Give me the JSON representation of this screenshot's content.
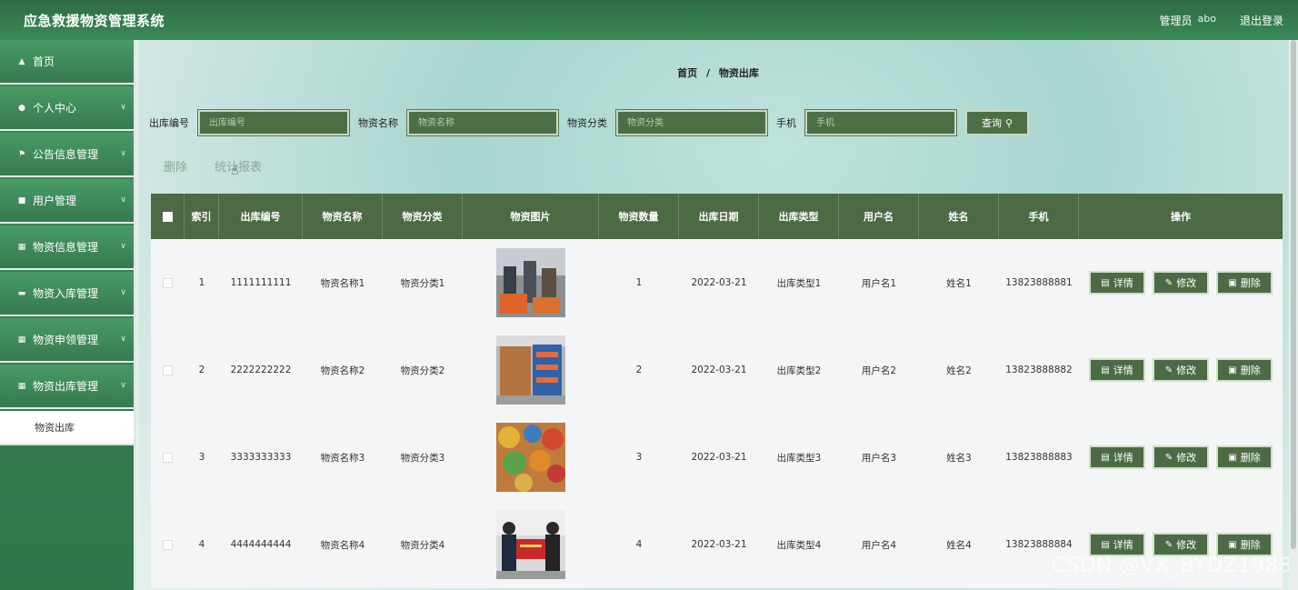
{
  "app": {
    "title": "应急救援物资管理系统"
  },
  "topbar": {
    "role_label": "管理员",
    "username": "abo",
    "logout_label": "退出登录"
  },
  "sidebar": {
    "items": [
      {
        "label": "首页",
        "icon": "home-icon",
        "has_children": false
      },
      {
        "label": "个人中心",
        "icon": "user-icon",
        "has_children": true
      },
      {
        "label": "公告信息管理",
        "icon": "flag-icon",
        "has_children": true
      },
      {
        "label": "用户管理",
        "icon": "card-icon",
        "has_children": true
      },
      {
        "label": "物资信息管理",
        "icon": "grid-icon",
        "has_children": true
      },
      {
        "label": "物资入库管理",
        "icon": "chat-icon",
        "has_children": true
      },
      {
        "label": "物资申领管理",
        "icon": "grid-icon",
        "has_children": true
      },
      {
        "label": "物资出库管理",
        "icon": "grid-icon",
        "has_children": true
      }
    ],
    "active_sub": "物资出库"
  },
  "breadcrumb": {
    "home": "首页",
    "separator": "/",
    "current": "物资出库"
  },
  "search": {
    "fields": [
      {
        "label": "出库编号",
        "placeholder": "出库编号",
        "value": ""
      },
      {
        "label": "物资名称",
        "placeholder": "物资名称",
        "value": ""
      },
      {
        "label": "物资分类",
        "placeholder": "物资分类",
        "value": ""
      },
      {
        "label": "手机",
        "placeholder": "手机",
        "value": ""
      }
    ],
    "query_label": "查询"
  },
  "actions": {
    "delete_label": "删除",
    "report_label": "统计报表"
  },
  "table": {
    "headers": [
      "索引",
      "出库编号",
      "物资名称",
      "物资分类",
      "物资图片",
      "物资数量",
      "出库日期",
      "出库类型",
      "用户名",
      "姓名",
      "手机",
      "操作"
    ],
    "rows": [
      {
        "index": "1",
        "code": "1111111111",
        "name": "物资名称1",
        "category": "物资分类1",
        "qty": "1",
        "date": "2022-03-21",
        "type": "出库类型1",
        "username": "用户名1",
        "realname": "姓名1",
        "phone": "13823888881"
      },
      {
        "index": "2",
        "code": "2222222222",
        "name": "物资名称2",
        "category": "物资分类2",
        "qty": "2",
        "date": "2022-03-21",
        "type": "出库类型2",
        "username": "用户名2",
        "realname": "姓名2",
        "phone": "13823888882"
      },
      {
        "index": "3",
        "code": "3333333333",
        "name": "物资名称3",
        "category": "物资分类3",
        "qty": "3",
        "date": "2022-03-21",
        "type": "出库类型3",
        "username": "用户名3",
        "realname": "姓名3",
        "phone": "13823888883"
      },
      {
        "index": "4",
        "code": "4444444444",
        "name": "物资名称4",
        "category": "物资分类4",
        "qty": "4",
        "date": "2022-03-21",
        "type": "出库类型4",
        "username": "用户名4",
        "realname": "姓名4",
        "phone": "13823888884"
      }
    ],
    "op_labels": {
      "detail": "详情",
      "edit": "修改",
      "delete": "删除"
    }
  },
  "watermark": "CSDN @VX_BYDZ1988",
  "colors": {
    "primary": "#3a8a58",
    "table_header": "#4c6b45",
    "button": "#4d6f45"
  }
}
